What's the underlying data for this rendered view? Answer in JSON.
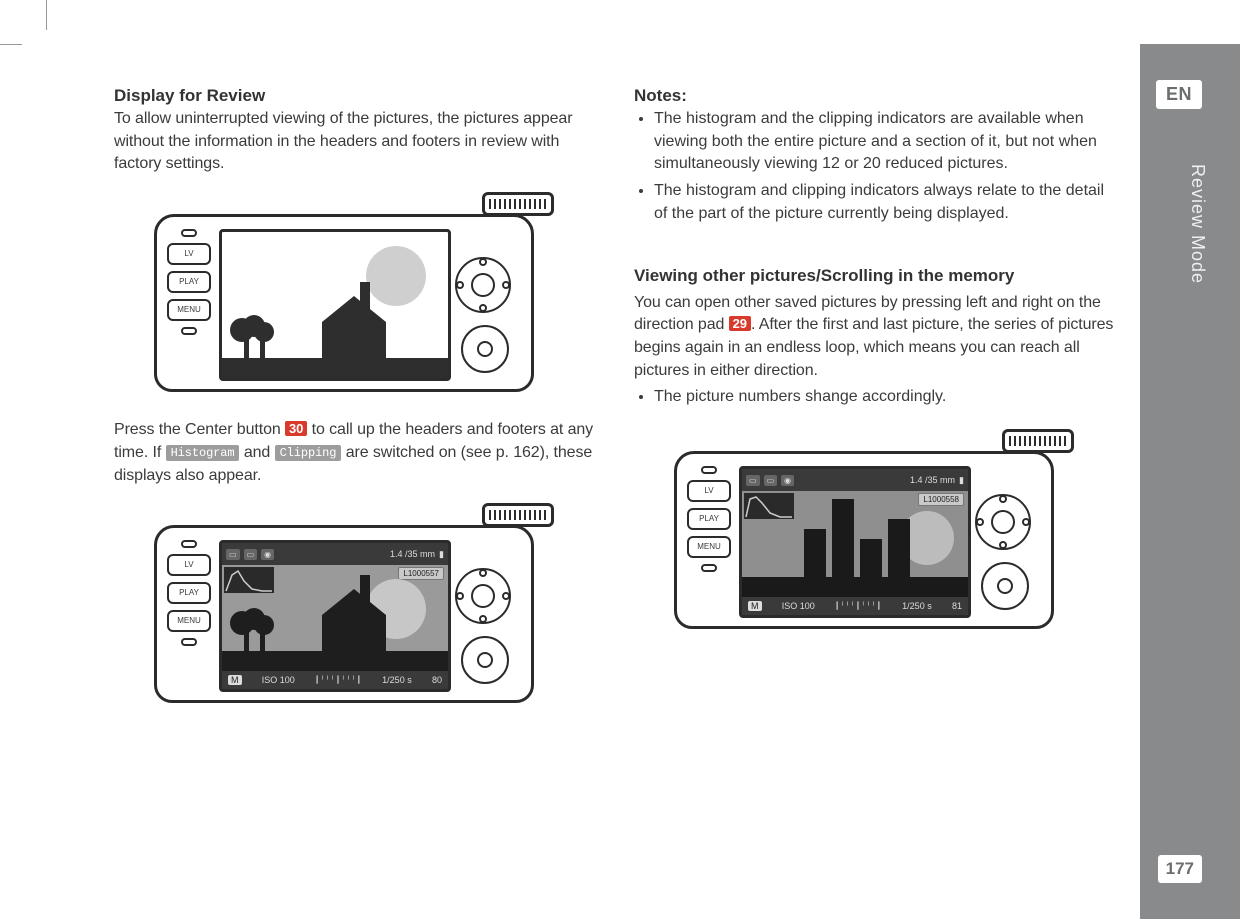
{
  "sidebar": {
    "lang": "EN",
    "section": "Review Mode",
    "page": "177"
  },
  "left": {
    "heading1": "Display for Review",
    "para1": "To allow uninterrupted viewing of the pictures, the pictures appear without the information in the headers and footers in review with factory settings.",
    "para2_a": "Press the Center button ",
    "ref30": "30",
    "para2_b": " to call up the headers and footers at any time. If ",
    "chip_histogram": "Histogram",
    "para2_c": " and ",
    "chip_clipping": "Clipping",
    "para2_d": " are switched on (see p. 162), these displays also appear.",
    "figure2": {
      "top_lens": "1.4 /35 mm",
      "file_label": "L1000557",
      "bot_mode": "M",
      "bot_iso": "ISO 100",
      "bot_shutter": "1/250 s",
      "bot_count": "80"
    }
  },
  "right": {
    "notes_heading": "Notes:",
    "note1": "The histogram and the clipping indicators are available when viewing both the entire picture and a section of it, but not when simultaneously viewing 12 or 20 reduced pictures.",
    "note2": "The histogram and clipping indicators always relate to the detail of the part of the picture currently being displayed.",
    "heading2": "Viewing other pictures/Scrolling in the memory",
    "para3_a": "You can open other saved pictures by pressing left and right on the direction pad ",
    "ref29": "29",
    "para3_b": ". After the first and last picture, the series of pictures begins again in an endless loop, which means you can reach all pictures in either direction.",
    "bullet3": "The picture numbers shange accordingly.",
    "figure3": {
      "top_lens": "1.4 /35 mm",
      "file_label": "L1000558",
      "bot_mode": "M",
      "bot_iso": "ISO 100",
      "bot_shutter": "1/250 s",
      "bot_count": "81"
    }
  },
  "camera_labels": {
    "lv": "LV",
    "play": "PLAY",
    "menu": "MENU"
  }
}
